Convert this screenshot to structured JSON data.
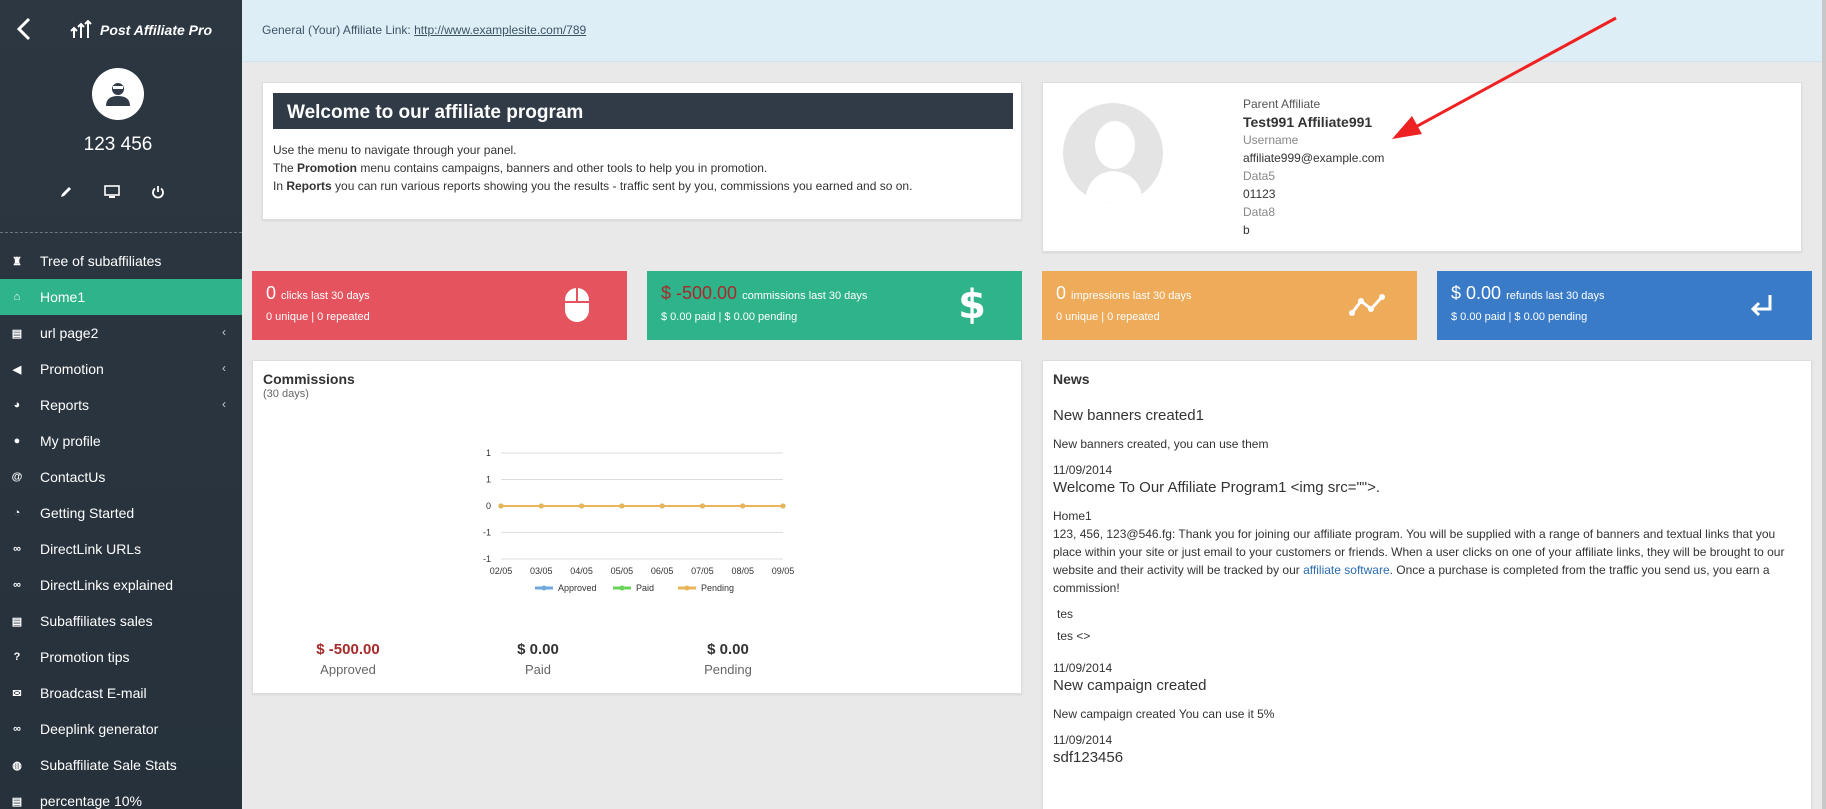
{
  "app": {
    "name": "Post Affiliate Pro"
  },
  "user": {
    "display_name": "123 456"
  },
  "topbar": {
    "label": "General (Your) Affiliate Link:",
    "link": "http://www.examplesite.com/789"
  },
  "sidebar": {
    "items": [
      {
        "label": "Tree of subaffiliates",
        "icon": "sitemap-icon",
        "chevron": false
      },
      {
        "label": "Home1",
        "icon": "home-icon",
        "chevron": false,
        "active": true
      },
      {
        "label": "url page2",
        "icon": "book-icon",
        "chevron": true
      },
      {
        "label": "Promotion",
        "icon": "bullhorn-icon",
        "chevron": true
      },
      {
        "label": "Reports",
        "icon": "pie-chart-icon",
        "chevron": true
      },
      {
        "label": "My profile",
        "icon": "user-icon",
        "chevron": false
      },
      {
        "label": "ContactUs",
        "icon": "at-icon",
        "chevron": false
      },
      {
        "label": "Getting Started",
        "icon": "stopwatch-icon",
        "chevron": false
      },
      {
        "label": "DirectLink URLs",
        "icon": "link-icon",
        "chevron": false
      },
      {
        "label": "DirectLinks explained",
        "icon": "link-icon",
        "chevron": false
      },
      {
        "label": "Subaffiliates sales",
        "icon": "book-icon",
        "chevron": false
      },
      {
        "label": "Promotion tips",
        "icon": "question-icon",
        "chevron": false
      },
      {
        "label": "Broadcast E-mail",
        "icon": "send-icon",
        "chevron": false
      },
      {
        "label": "Deeplink generator",
        "icon": "link-icon",
        "chevron": false
      },
      {
        "label": "Subaffiliate Sale Stats",
        "icon": "globe-icon",
        "chevron": false
      },
      {
        "label": "percentage 10%",
        "icon": "book-icon",
        "chevron": false
      }
    ]
  },
  "welcome": {
    "title": "Welcome to our affiliate program",
    "line1": "Use the menu to navigate through your panel.",
    "line2_pre": "The ",
    "line2_bold": "Promotion",
    "line2_post": " menu contains campaigns, banners and other tools to help you in promotion.",
    "line3_pre": "In ",
    "line3_bold": "Reports",
    "line3_post": " you can run various reports showing you the results - traffic sent by you, commissions you earned and so on."
  },
  "parent": {
    "label": "Parent Affiliate",
    "name": "Test991 Affiliate991",
    "username_label": "Username",
    "username": "affiliate999@example.com",
    "data5_label": "Data5",
    "data5": "01123",
    "data8_label": "Data8",
    "data8": "b"
  },
  "stats": {
    "clicks": {
      "value": "0",
      "label": "clicks last 30 days",
      "sub": "0 unique | 0 repeated",
      "color": "#e5535f",
      "icon": "mouse-icon"
    },
    "commissions": {
      "value": "$ -500.00",
      "label": "commissions last 30 days",
      "sub": "$ 0.00 paid | $ 0.00 pending",
      "color": "#2fb38a",
      "icon": "dollar-icon"
    },
    "impressions": {
      "value": "0",
      "label": "impressions last 30 days",
      "sub": "0 unique | 0 repeated",
      "color": "#eeab5a",
      "icon": "line-chart-icon"
    },
    "refunds": {
      "value": "$ 0.00",
      "label": "refunds last 30 days",
      "sub": "$ 0.00 paid | $ 0.00 pending",
      "color": "#3a7bc8",
      "icon": "return-icon"
    }
  },
  "commissions": {
    "title": "Commissions",
    "subtitle": "(30 days)",
    "totals": [
      {
        "value": "$ -500.00",
        "label": "Approved"
      },
      {
        "value": "$ 0.00",
        "label": "Paid"
      },
      {
        "value": "$ 0.00",
        "label": "Pending"
      }
    ]
  },
  "chart_data": {
    "type": "line",
    "x": [
      "02/05",
      "03/05",
      "04/05",
      "05/05",
      "06/05",
      "07/05",
      "08/05",
      "09/05"
    ],
    "yticks": [
      "1",
      "1",
      "0",
      "-1",
      "-1"
    ],
    "ylim": [
      -1,
      1
    ],
    "series": [
      {
        "name": "Approved",
        "color": "#6fa8dc",
        "values": [
          0,
          0,
          0,
          0,
          0,
          0,
          0,
          0
        ]
      },
      {
        "name": "Paid",
        "color": "#6ad45a",
        "values": [
          0,
          0,
          0,
          0,
          0,
          0,
          0,
          0
        ]
      },
      {
        "name": "Pending",
        "color": "#e9b45a",
        "values": [
          0,
          0,
          0,
          0,
          0,
          0,
          0,
          0
        ]
      }
    ],
    "legend": "bottom",
    "grid": true
  },
  "news": {
    "title": "News",
    "items": [
      {
        "title": "New banners created1",
        "date": "",
        "body": "New banners created, you can use them"
      },
      {
        "date": "11/09/2014",
        "title": "Welcome To Our Affiliate Program1 <img src=\"\">."
      },
      {
        "date": "11/09/2014",
        "title": "New campaign created",
        "body": "New campaign created You can use it 5%"
      },
      {
        "date": "11/09/2014",
        "title": "sdf123456"
      }
    ],
    "welcome_body_home": "Home1",
    "welcome_body_pre": "123, 456, 123@546.fg: Thank you for joining our affiliate program. You will be supplied with a range of banners and textual links that you place within your site or just email to your customers or friends. When a user clicks on one of your affiliate links, they will be brought to our website and their activity will be tracked by our ",
    "welcome_body_link": "affiliate software",
    "welcome_body_post": ". Once a purchase is completed from the traffic you send us, you earn a commission!",
    "tes1": "tes",
    "tes2": "tes <>"
  }
}
